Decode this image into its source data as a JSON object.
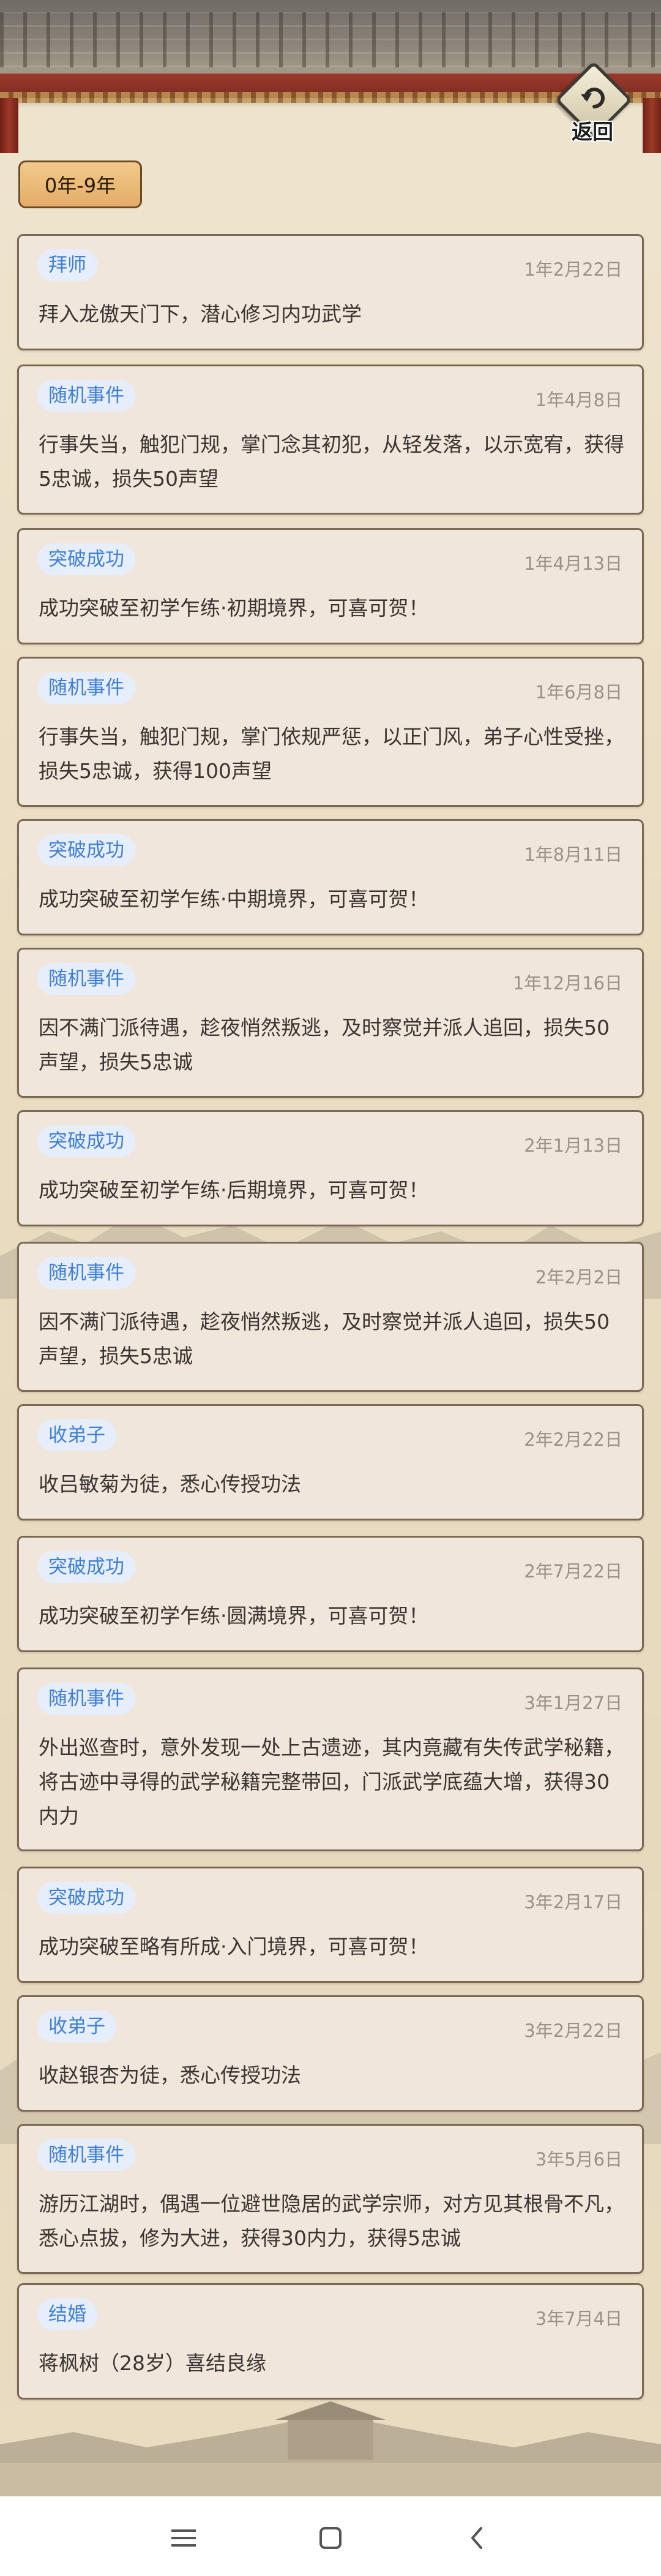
{
  "header": {
    "back_label": "返回"
  },
  "period_tab": "0年-9年",
  "events": [
    {
      "tag": "拜师",
      "date": "1年2月22日",
      "text": "拜入龙傲天门下，潜心修习内功武学"
    },
    {
      "tag": "随机事件",
      "date": "1年4月8日",
      "text": "行事失当，触犯门规，掌门念其初犯，从轻发落，以示宽宥，获得5忠诚，损失50声望"
    },
    {
      "tag": "突破成功",
      "date": "1年4月13日",
      "text": "成功突破至初学乍练·初期境界，可喜可贺！"
    },
    {
      "tag": "随机事件",
      "date": "1年6月8日",
      "text": "行事失当，触犯门规，掌门依规严惩，以正门风，弟子心性受挫，损失5忠诚，获得100声望"
    },
    {
      "tag": "突破成功",
      "date": "1年8月11日",
      "text": "成功突破至初学乍练·中期境界，可喜可贺！"
    },
    {
      "tag": "随机事件",
      "date": "1年12月16日",
      "text": "因不满门派待遇，趁夜悄然叛逃，及时察觉并派人追回，损失50声望，损失5忠诚"
    },
    {
      "tag": "突破成功",
      "date": "2年1月13日",
      "text": "成功突破至初学乍练·后期境界，可喜可贺！"
    },
    {
      "tag": "随机事件",
      "date": "2年2月2日",
      "text": "因不满门派待遇，趁夜悄然叛逃，及时察觉并派人追回，损失50声望，损失5忠诚"
    },
    {
      "tag": "收弟子",
      "date": "2年2月22日",
      "text": "收吕敏菊为徒，悉心传授功法"
    },
    {
      "tag": "突破成功",
      "date": "2年7月22日",
      "text": "成功突破至初学乍练·圆满境界，可喜可贺！"
    },
    {
      "tag": "随机事件",
      "date": "3年1月27日",
      "text": "外出巡查时，意外发现一处上古遗迹，其内竟藏有失传武学秘籍，将古迹中寻得的武学秘籍完整带回，门派武学底蕴大增，获得30内力"
    },
    {
      "tag": "突破成功",
      "date": "3年2月17日",
      "text": "成功突破至略有所成·入门境界，可喜可贺！"
    },
    {
      "tag": "收弟子",
      "date": "3年2月22日",
      "text": "收赵银杏为徒，悉心传授功法"
    },
    {
      "tag": "随机事件",
      "date": "3年5月6日",
      "text": "游历江湖时，偶遇一位避世隐居的武学宗师，对方见其根骨不凡，悉心点拔，修为大进，获得30内力，获得5忠诚"
    },
    {
      "tag": "结婚",
      "date": "3年7月4日",
      "text": "蒋枫树（28岁）喜结良缘"
    }
  ]
}
